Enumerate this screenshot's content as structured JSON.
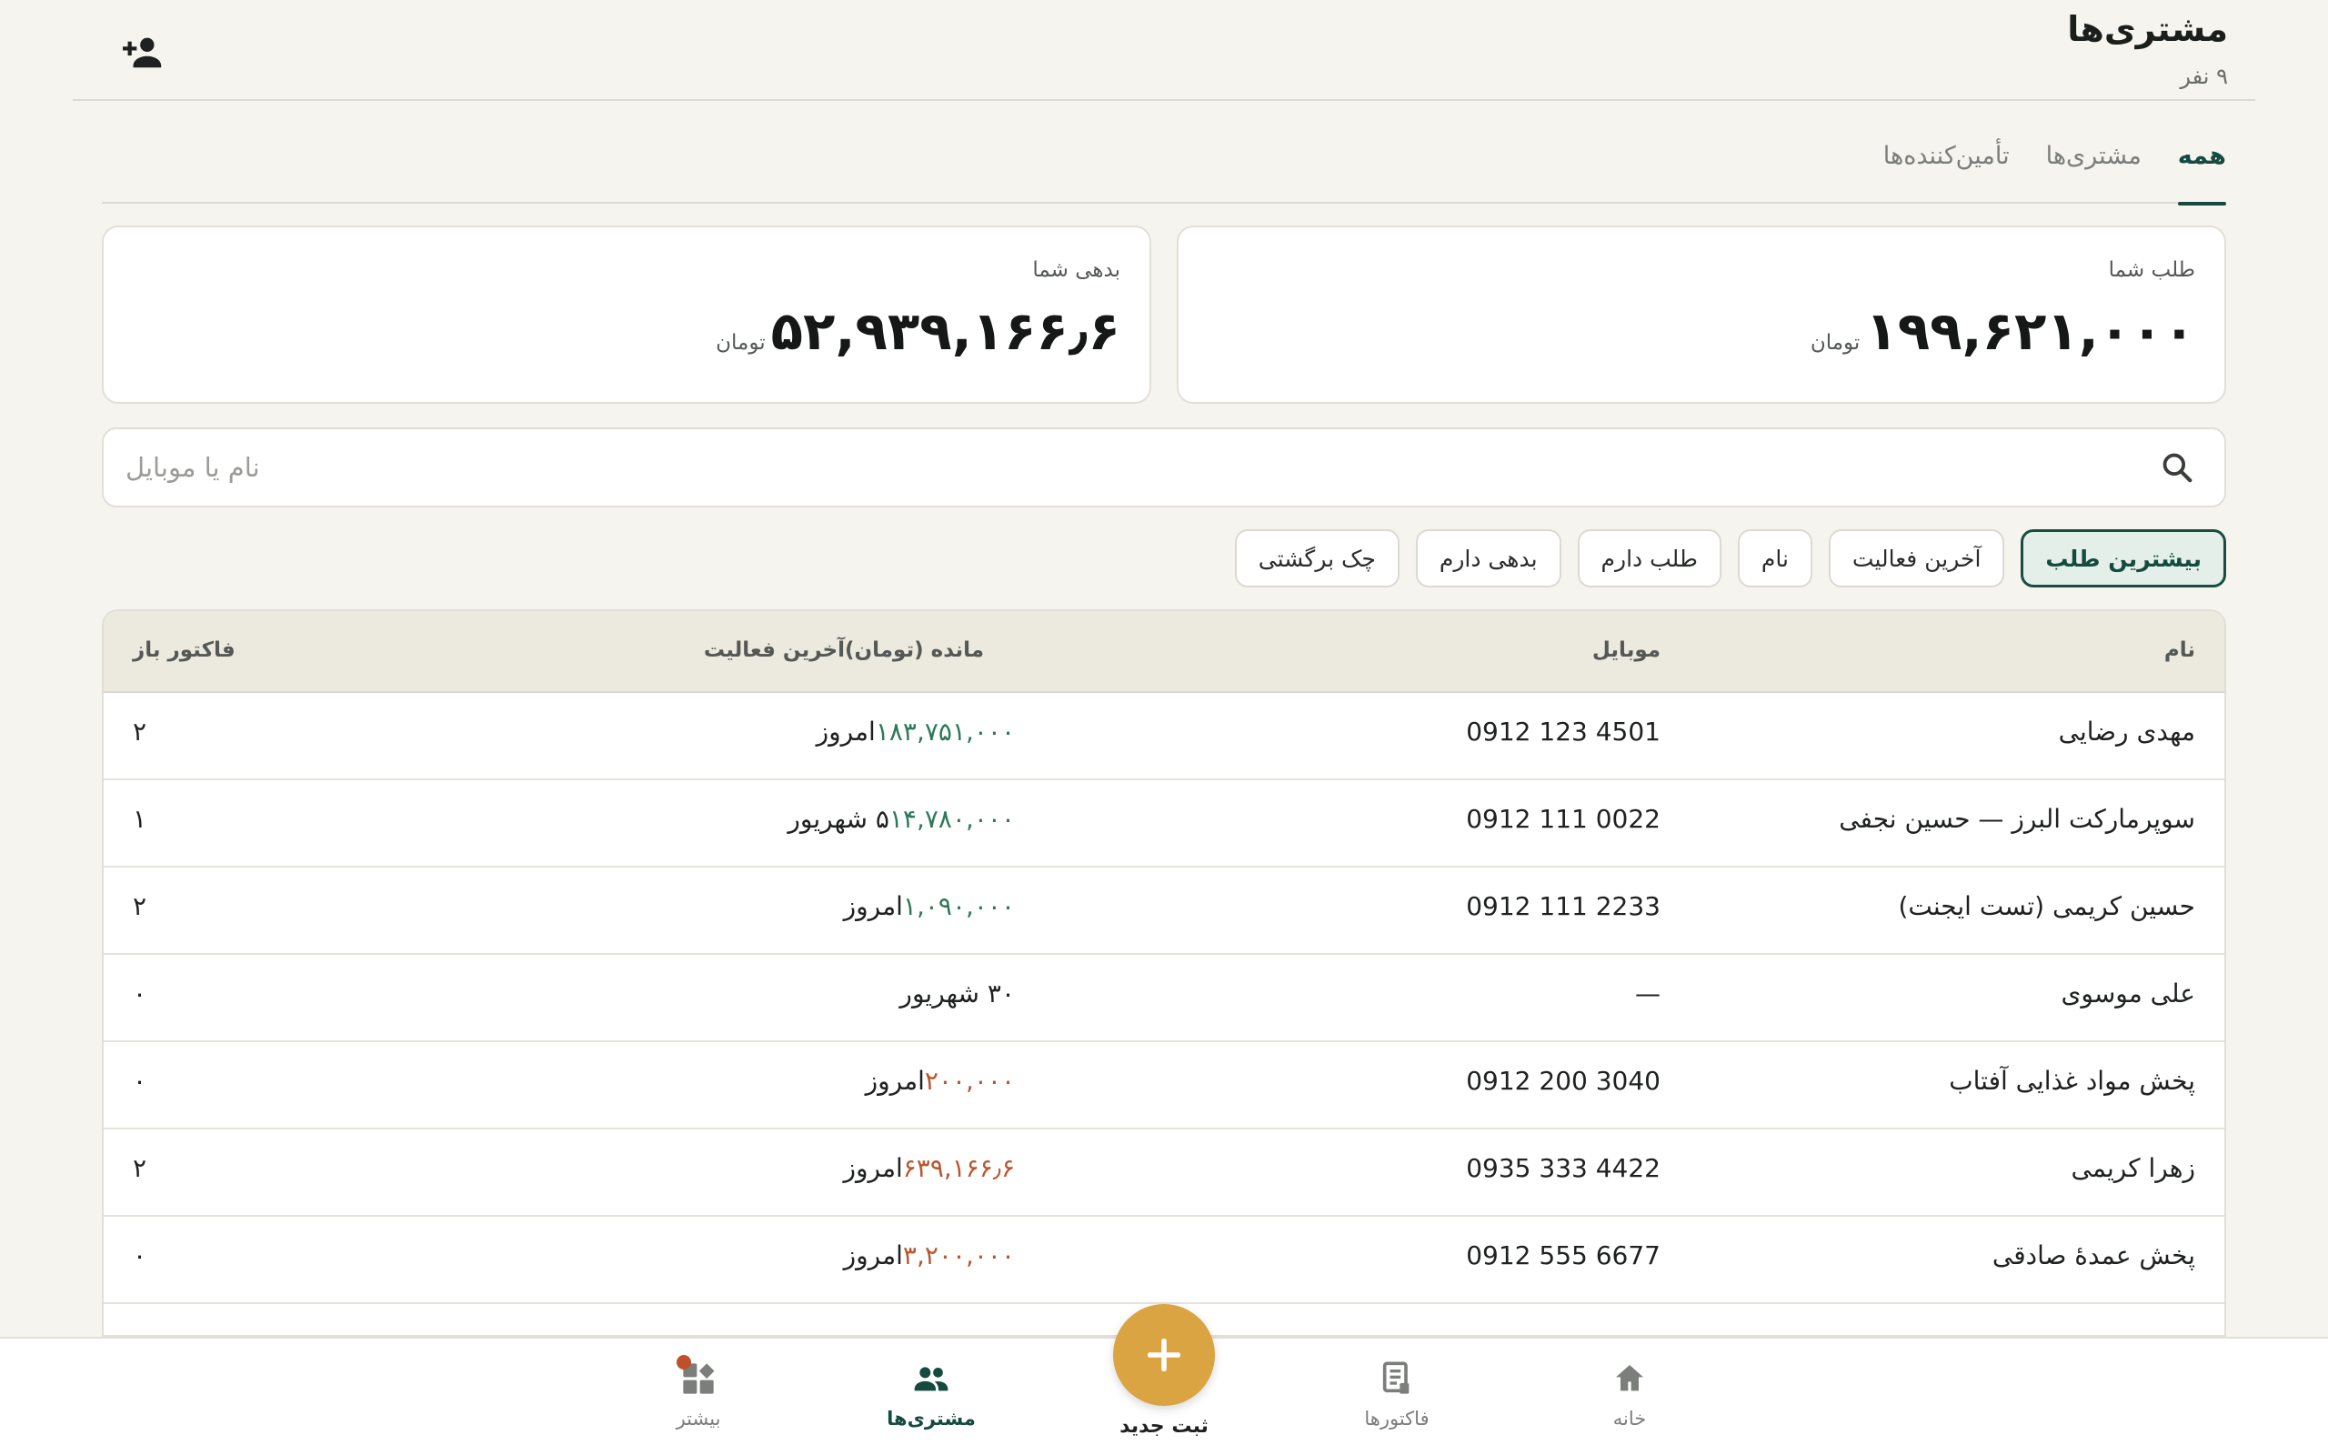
{
  "header": {
    "title": "مشتری‌ها",
    "subtitle": "۹ نفر",
    "add_icon": "add-user-icon"
  },
  "tabs": [
    {
      "label": "همه",
      "active": true
    },
    {
      "label": "مشتری‌ها",
      "active": false
    },
    {
      "label": "تأمین‌کننده‌ها",
      "active": false
    }
  ],
  "summary": {
    "credit": {
      "label": "طلب شما",
      "amount": "۱۹۹,۶۲۱,۰۰۰",
      "unit": "تومان"
    },
    "debt": {
      "label": "بدهی شما",
      "amount": "۵۲,۹۳۹,۱۶۶٫۶",
      "unit": "تومان"
    }
  },
  "search": {
    "placeholder": "نام یا موبایل",
    "value": ""
  },
  "filters": [
    {
      "label": "بیشترین طلب",
      "active": true
    },
    {
      "label": "آخرین فعالیت",
      "active": false
    },
    {
      "label": "نام",
      "active": false
    },
    {
      "label": "طلب دارم",
      "active": false
    },
    {
      "label": "بدهی دارم",
      "active": false
    },
    {
      "label": "چک برگشتی",
      "active": false
    }
  ],
  "table": {
    "columns": {
      "name": "نام",
      "mobile": "موبایل",
      "balance_activity": "مانده (تومان)آخرین فعالیت",
      "open_invoices": "فاکتور باز"
    },
    "rows": [
      {
        "name": "مهدی رضایی",
        "mobile": "0912 123 4501",
        "balance": "۱۸۳,۷۵۱,۰۰۰",
        "balance_type": "pos",
        "activity": "امروز",
        "open": "۲"
      },
      {
        "name": "سوپرمارکت البرز — حسین نجفی",
        "mobile": "0912 111 0022",
        "balance": "۱۴,۷۸۰,۰۰۰",
        "balance_type": "pos",
        "activity": "۵ شهریور",
        "open": "۱"
      },
      {
        "name": "حسین کریمی (تست ایجنت)",
        "mobile": "0912 111 2233",
        "balance": "۱,۰۹۰,۰۰۰",
        "balance_type": "pos",
        "activity": "امروز",
        "open": "۲"
      },
      {
        "name": "علی موسوی",
        "mobile": "—",
        "balance": "",
        "balance_type": "pos",
        "activity": "۳۰ شهریور",
        "open": "۰"
      },
      {
        "name": "پخش مواد غذایی آفتاب",
        "mobile": "0912 200 3040",
        "balance": "۲۰۰,۰۰۰",
        "balance_type": "neg",
        "activity": "امروز",
        "open": "۰"
      },
      {
        "name": "زهرا کریمی",
        "mobile": "0935 333 4422",
        "balance": "۶۳۹,۱۶۶٫۶",
        "balance_type": "neg",
        "activity": "امروز",
        "open": "۲"
      },
      {
        "name": "پخش عمدهٔ صادقی",
        "mobile": "0912 555 6677",
        "balance": "۳,۲۰۰,۰۰۰",
        "balance_type": "neg",
        "activity": "امروز",
        "open": "۰"
      }
    ]
  },
  "bottom_nav": {
    "items": [
      {
        "label": "خانه",
        "icon": "home-icon",
        "active": false
      },
      {
        "label": "فاکتورها",
        "icon": "invoice-icon",
        "active": false
      },
      {
        "label": "مشتری‌ها",
        "icon": "people-icon",
        "active": true
      },
      {
        "label": "بیشتر",
        "icon": "more-icon",
        "active": false
      }
    ],
    "fab_label": "ثبت جدید",
    "fab_icon": "plus-icon"
  },
  "colors": {
    "primary": "#154a3f",
    "positive": "#2d7a5a",
    "negative": "#b8572f",
    "accent": "#d9a441",
    "background": "#f6f4ee"
  }
}
